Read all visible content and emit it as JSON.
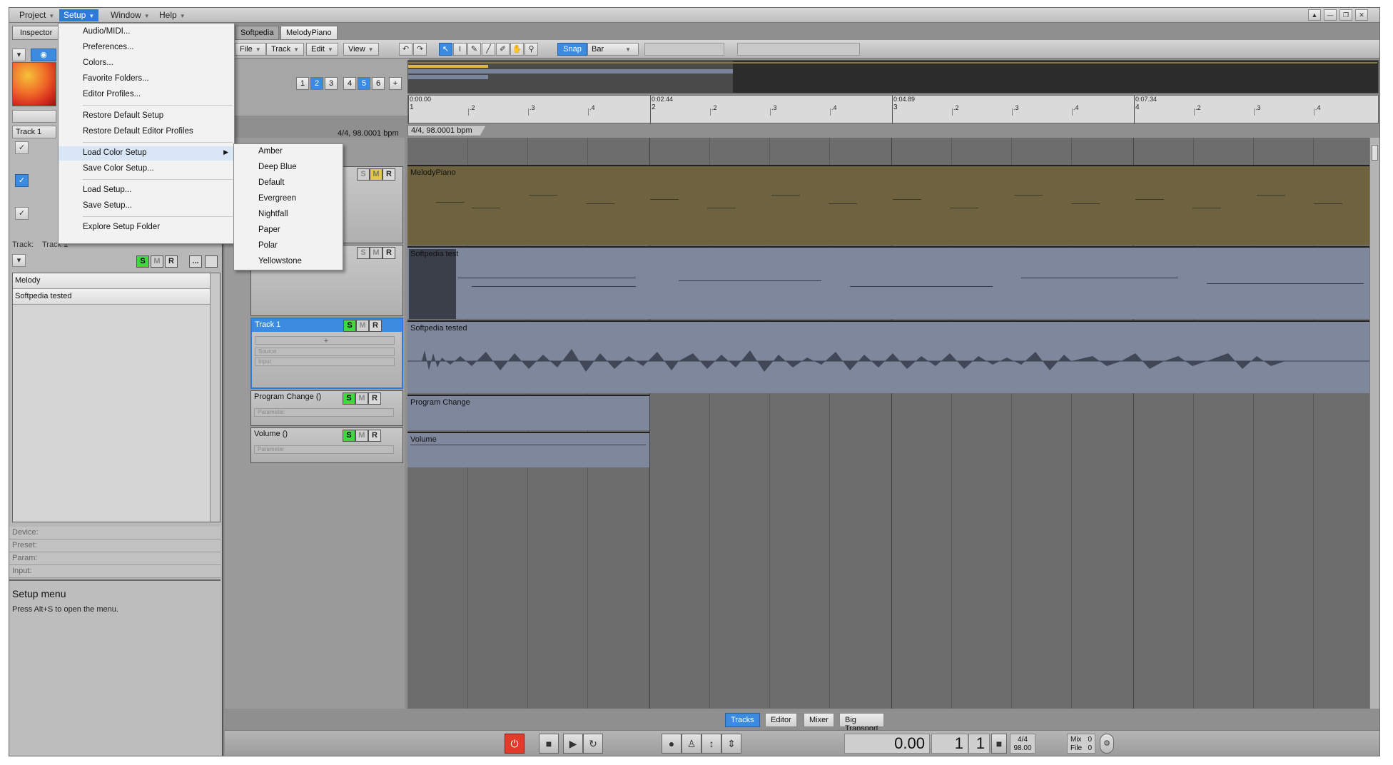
{
  "menubar": {
    "items": [
      {
        "label": "Project"
      },
      {
        "label": "Setup"
      },
      {
        "label": "Window"
      },
      {
        "label": "Help"
      }
    ]
  },
  "window_controls": {
    "up": "▲",
    "min": "—",
    "restore": "❐",
    "close": "✕"
  },
  "inspector": {
    "tab_label": "Inspector",
    "track_label": "Track 1",
    "track_prefix": "Track:",
    "track_value": "Track 1",
    "ellipsis": "...",
    "tracks": [
      "Melody",
      "Softpedia tested"
    ],
    "info_rows": [
      "Device:",
      "Preset:",
      "Param:",
      "Input:"
    ],
    "help_title": "Setup menu",
    "help_text": "Press Alt+S to open the menu."
  },
  "doc_tabs": [
    "Softpedia",
    "MelodyPiano"
  ],
  "toolbar": {
    "menus": [
      "File",
      "Track",
      "Edit",
      "View"
    ],
    "snap": "Snap",
    "grid": "Bar"
  },
  "pages": [
    "1",
    "2",
    "3",
    "4",
    "5",
    "6",
    "+"
  ],
  "ruler": {
    "times": [
      "0:00.00",
      "0:02.44",
      "0:04.89",
      "0:07.34"
    ],
    "bars": [
      "1",
      "2",
      "3",
      "4"
    ],
    "beats": [
      ".2",
      ".3",
      ".4"
    ],
    "tempo_left": "4/4, 98.0001 bpm",
    "tempo_right": "4/4, 98.0001 bpm"
  },
  "tracks": [
    {
      "name": "",
      "clip": "MelodyPiano"
    },
    {
      "name": "",
      "clip": "Softpedia test"
    },
    {
      "name": "Track 1",
      "clip": "Softpedia tested"
    },
    {
      "name": "Program Change ()",
      "clip": "Program Change",
      "sub": "Parameter"
    },
    {
      "name": "Volume ()",
      "clip": "Volume",
      "sub": "Parameter"
    }
  ],
  "track_header_sub": {
    "source": "Source",
    "input": "Input",
    "add": "+"
  },
  "buttons": {
    "s": "S",
    "m": "M",
    "r": "R"
  },
  "view_tabs": [
    "Tracks",
    "Editor",
    "Mixer",
    "Big Transport"
  ],
  "transport": {
    "time": "0.00",
    "bar": "1",
    "beat": "1",
    "sig": "4/4",
    "bpm": "98.00",
    "mix_label": "Mix",
    "file_label": "File",
    "mix_val": "0",
    "file_val": "0"
  },
  "setup_menu": {
    "items": [
      "Audio/MIDI...",
      "Preferences...",
      "Colors...",
      "Favorite Folders...",
      "Editor Profiles...",
      "Restore Default Setup",
      "Restore Default Editor Profiles",
      "Load Color Setup",
      "Save Color Setup...",
      "Load Setup...",
      "Save Setup...",
      "Explore Setup Folder"
    ]
  },
  "color_menu": {
    "items": [
      "Amber",
      "Deep Blue",
      "Default",
      "Evergreen",
      "Nightfall",
      "Paper",
      "Polar",
      "Yellowstone"
    ]
  },
  "colors": {
    "accent": "#3b8be0",
    "melody_lane": "#6e623f",
    "audio_lane": "#7e879c",
    "solo_green": "#3fd83f",
    "power_red": "#e33a2a"
  }
}
